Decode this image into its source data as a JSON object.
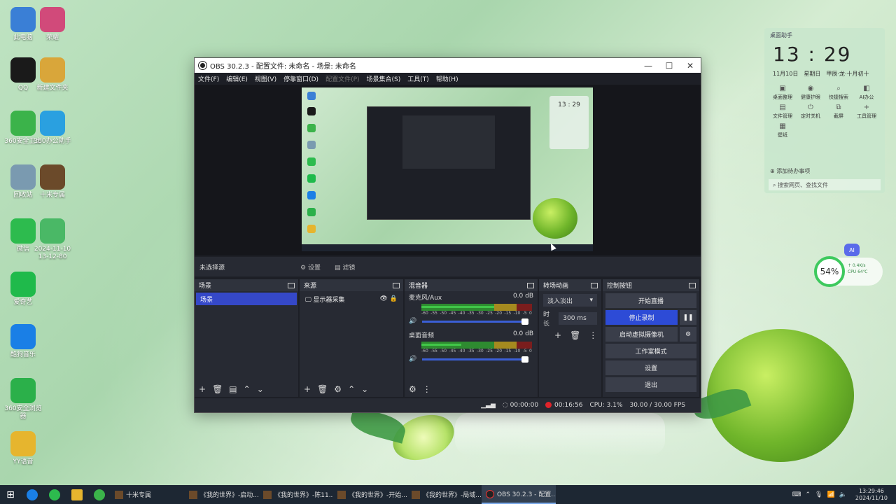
{
  "desktop_icons": [
    {
      "label": "此电脑",
      "color": "#3a7fd6"
    },
    {
      "label": "荣耀",
      "color": "#d14a7a"
    },
    {
      "label": "QQ",
      "color": "#1a1a1a"
    },
    {
      "label": "新建文件夹",
      "color": "#d9a63a"
    },
    {
      "label": "360安全卫士",
      "color": "#3bb34a"
    },
    {
      "label": "360办公助手",
      "color": "#2aa0e0"
    },
    {
      "label": "回收站",
      "color": "#7a9ab0"
    },
    {
      "label": "十米专属",
      "color": "#6b4a2a"
    },
    {
      "label": "微信",
      "color": "#2dbb4e"
    },
    {
      "label": "2024-11-10\n13-12-80",
      "color": "#4ab866"
    },
    {
      "label": "爱奇艺",
      "color": "#1fba4b"
    },
    {
      "label": "酷狗音乐",
      "color": "#1a7fe6"
    },
    {
      "label": "360安全浏览器",
      "color": "#2bb04a"
    },
    {
      "label": "YY语音",
      "color": "#e6b52e"
    }
  ],
  "obs": {
    "window_title": "OBS 30.2.3 - 配置文件: 未命名 - 场景: 未命名",
    "window_controls": {
      "minimize": "—",
      "maximize": "☐",
      "close": "✕"
    },
    "menu": [
      "文件(F)",
      "编辑(E)",
      "视图(V)",
      "停靠窗口(D)",
      "配置文件(P)",
      "场景集合(S)",
      "工具(T)",
      "帮助(H)"
    ],
    "source_bar": {
      "no_source": "未选择源",
      "settings": "设置",
      "filters": "滤镜"
    },
    "scenes": {
      "title": "场景",
      "items": [
        "场景"
      ]
    },
    "sources": {
      "title": "来源",
      "items": [
        "显示器采集"
      ]
    },
    "mixer": {
      "title": "混音器",
      "channels": [
        {
          "name": "麦克风/Aux",
          "db": "0.0 dB",
          "level": 0.82
        },
        {
          "name": "桌面音频",
          "db": "0.0 dB",
          "level": 0.45
        }
      ],
      "ticks": [
        "-60",
        "-55",
        "-50",
        "-45",
        "-40",
        "-35",
        "-30",
        "-25",
        "-20",
        "-15",
        "-10",
        "-5",
        "0"
      ]
    },
    "transitions": {
      "title": "转场动画",
      "selected": "淡入淡出",
      "duration_label": "时长",
      "duration": "300 ms"
    },
    "controls": {
      "title": "控制按钮",
      "start_stream": "开始直播",
      "stop_record": "停止录制",
      "virtual_cam": "启动虚拟摄像机",
      "studio_mode": "工作室模式",
      "settings": "设置",
      "exit": "退出"
    },
    "status": {
      "stream_time": "00:00:00",
      "rec_time": "00:16:56",
      "cpu": "CPU: 3.1%",
      "fps": "30.00 / 30.00 FPS"
    },
    "preview_mini_clock": "13 : 29"
  },
  "widget": {
    "title": "桌面助手",
    "time": "13 : 29",
    "date": "11月10日",
    "weekday": "星期日",
    "lunar": "甲辰·龙·十月初十",
    "grid": [
      {
        "label": "桌面整理",
        "icon": "▣"
      },
      {
        "label": "健康护眼",
        "icon": "◉"
      },
      {
        "label": "快捷搜索",
        "icon": "⌕"
      },
      {
        "label": "AI办公",
        "icon": "◧"
      },
      {
        "label": "文件管理",
        "icon": "▤"
      },
      {
        "label": "定时关机",
        "icon": "⏻"
      },
      {
        "label": "截屏",
        "icon": "⧉"
      },
      {
        "label": "工具管理",
        "icon": "+"
      },
      {
        "label": "壁纸",
        "icon": "▦"
      }
    ],
    "todo": "添加待办事项",
    "search": "搜索网页、查找文件"
  },
  "net_widget": {
    "percent": "54%",
    "speed": "↑ 0.4K/s",
    "cpu": "CPU 64℃"
  },
  "ai_badge": "AI",
  "taskbar": {
    "apps": [
      "十米专属",
      "《我的世界》-启动...",
      "《我的世界》-陈11...",
      "《我的世界》-开始...",
      "《我的世界》-局域...",
      "OBS 30.2.3 - 配置..."
    ],
    "time": "13:29:46",
    "date": "2024/11/10"
  }
}
